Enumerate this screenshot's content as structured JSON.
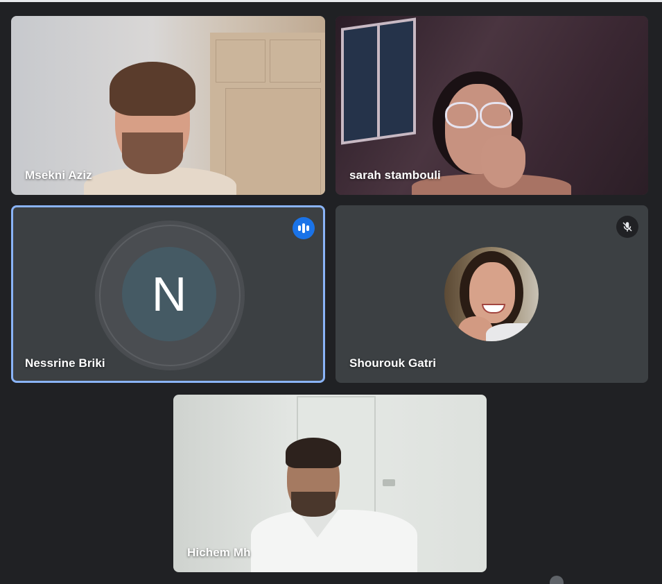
{
  "participants": [
    {
      "name": "Msekni Aziz"
    },
    {
      "name": "sarah stambouli"
    },
    {
      "name": "Nessrine Briki",
      "avatar_letter": "N",
      "speaking": true
    },
    {
      "name": "Shourouk Gatri",
      "muted": true
    },
    {
      "name": "Hichem Mh"
    }
  ],
  "colors": {
    "background": "#202124",
    "tile": "#3c4043",
    "active_border": "#8ab4f8",
    "speaking_badge": "#1a73e8",
    "avatar": "#455a64"
  },
  "icons": {
    "speaking": "audio-level-icon",
    "muted": "mic-off-icon"
  }
}
